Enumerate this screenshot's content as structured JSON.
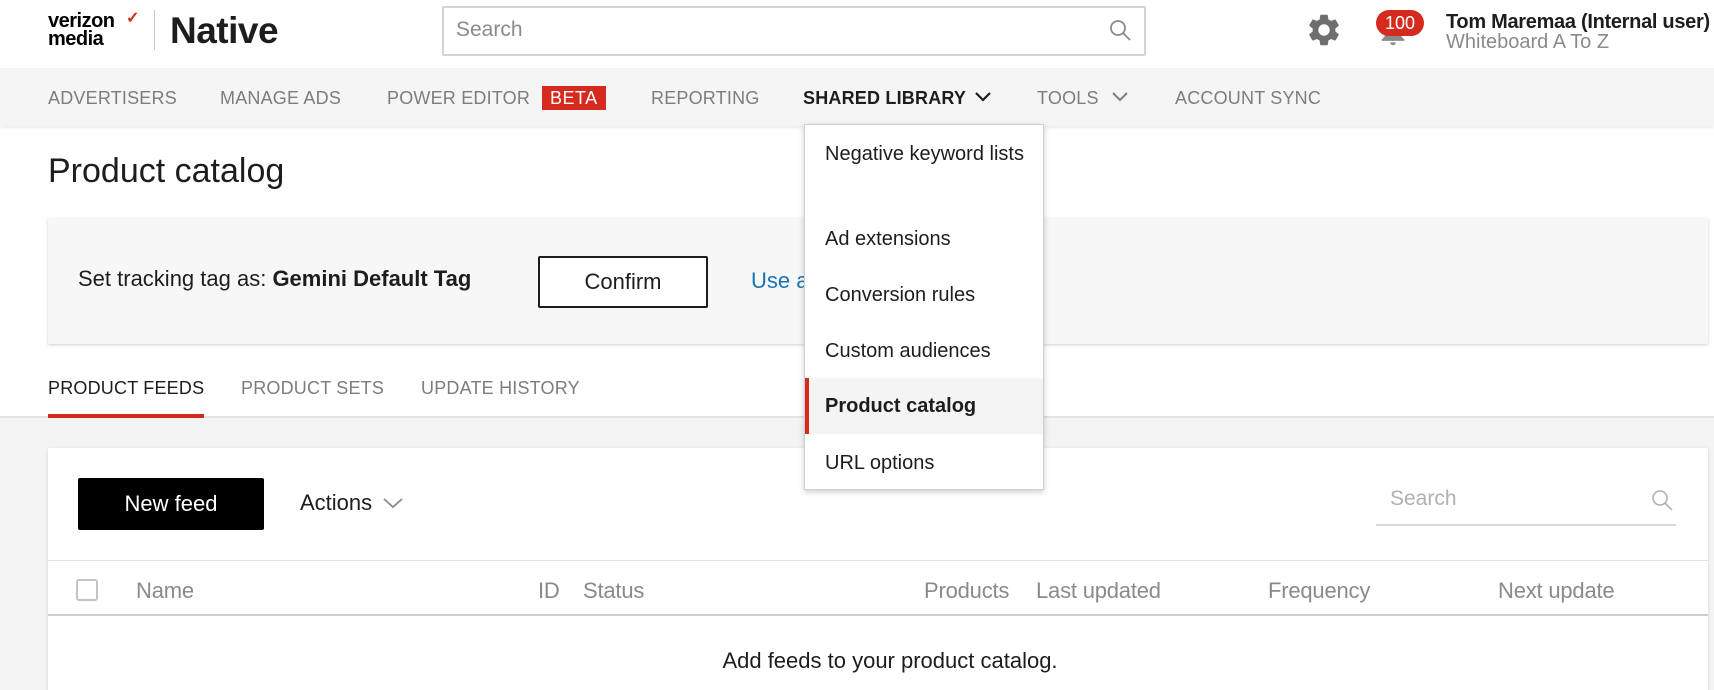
{
  "header": {
    "logo_line1": "verizon",
    "logo_line2": "media",
    "product_name": "Native",
    "search_placeholder": "Search",
    "notification_count": "100",
    "user_name": "Tom Maremaa (Internal user)",
    "account_name": "Whiteboard A To Z"
  },
  "nav": {
    "items": [
      {
        "label": "ADVERTISERS"
      },
      {
        "label": "MANAGE ADS"
      },
      {
        "label": "POWER EDITOR"
      },
      {
        "label": "REPORTING"
      },
      {
        "label": "SHARED LIBRARY"
      },
      {
        "label": "TOOLS"
      },
      {
        "label": "ACCOUNT SYNC"
      }
    ],
    "beta_label": "BETA",
    "active": "SHARED LIBRARY"
  },
  "dropdown": {
    "items": [
      {
        "label": "Negative keyword lists"
      },
      {
        "label": "Ad extensions"
      },
      {
        "label": "Conversion rules"
      },
      {
        "label": "Custom audiences"
      },
      {
        "label": "Product catalog"
      },
      {
        "label": "URL options"
      }
    ],
    "selected": "Product catalog"
  },
  "page": {
    "title": "Product catalog"
  },
  "banner": {
    "label": "Set tracking tag as: ",
    "tag_name": "Gemini Default Tag",
    "confirm_label": "Confirm",
    "link_text": "Use a"
  },
  "tabs": [
    {
      "label": "PRODUCT FEEDS"
    },
    {
      "label": "PRODUCT SETS"
    },
    {
      "label": "UPDATE HISTORY"
    }
  ],
  "active_tab": "PRODUCT FEEDS",
  "toolbar": {
    "new_feed_label": "New feed",
    "actions_label": "Actions",
    "search_placeholder": "Search"
  },
  "table": {
    "columns": [
      "Name",
      "ID",
      "Status",
      "Products",
      "Last updated",
      "Frequency",
      "Next update"
    ],
    "empty_message": "Add feeds to your product catalog."
  },
  "colors": {
    "accent": "#d52b1e",
    "link": "#1a73b5"
  }
}
